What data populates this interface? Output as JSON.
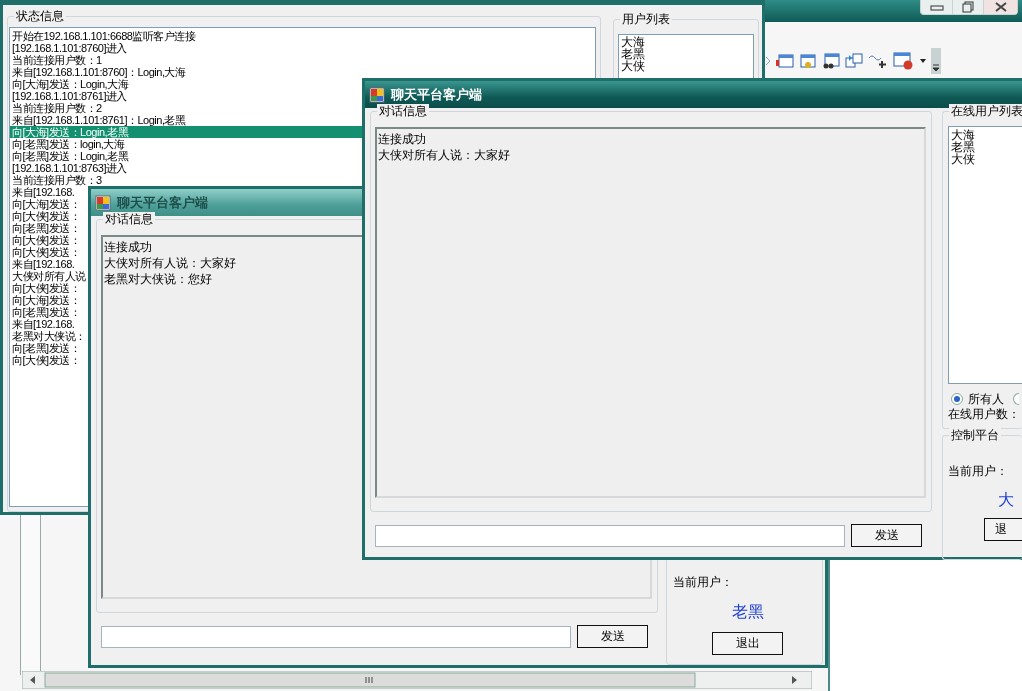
{
  "server_window": {
    "status_group": {
      "title": "状态信息",
      "lines": [
        {
          "text": "开始在192.168.1.101:6688监听客户连接",
          "selected": false
        },
        {
          "text": "[192.168.1.101:8760]进入",
          "selected": false
        },
        {
          "text": "当前连接用户数：1",
          "selected": false
        },
        {
          "text": "来自[192.168.1.101:8760]：Login,大海",
          "selected": false
        },
        {
          "text": "向[大海]发送：Login,大海",
          "selected": false
        },
        {
          "text": "[192.168.1.101:8761]进入",
          "selected": false
        },
        {
          "text": "当前连接用户数：2",
          "selected": false
        },
        {
          "text": "来自[192.168.1.101:8761]：Login,老黑",
          "selected": false
        },
        {
          "text": "向[大海]发送：Login,老黑",
          "selected": true
        },
        {
          "text": "向[老黑]发送：login,大海",
          "selected": false
        },
        {
          "text": "向[老黑]发送：Login,老黑",
          "selected": false
        },
        {
          "text": "[192.168.1.101:8763]进入",
          "selected": false
        },
        {
          "text": "当前连接用户数：3",
          "selected": false
        },
        {
          "text": "来自[192.168.",
          "selected": false
        },
        {
          "text": "向[大海]发送：",
          "selected": false
        },
        {
          "text": "向[大侠]发送：",
          "selected": false
        },
        {
          "text": "向[老黑]发送：",
          "selected": false
        },
        {
          "text": "向[大侠]发送：",
          "selected": false
        },
        {
          "text": "向[大侠]发送：",
          "selected": false
        },
        {
          "text": "来自[192.168.",
          "selected": false
        },
        {
          "text": "大侠对所有人说",
          "selected": false
        },
        {
          "text": "向[大侠]发送：",
          "selected": false
        },
        {
          "text": "向[大海]发送：",
          "selected": false
        },
        {
          "text": "向[老黑]发送：",
          "selected": false
        },
        {
          "text": "来自[192.168.",
          "selected": false
        },
        {
          "text": "老黑对大侠说：",
          "selected": false
        },
        {
          "text": "向[老黑]发送：",
          "selected": false
        },
        {
          "text": "向[大侠]发送：",
          "selected": false
        }
      ]
    },
    "users_group": {
      "title": "用户列表",
      "users": [
        "大海",
        "老黑",
        "大侠"
      ]
    }
  },
  "client_back": {
    "title": "聊天平台客户端",
    "active": false,
    "chat_group": {
      "title": "对话信息",
      "messages": [
        "连接成功",
        "大侠对所有人说：大家好",
        "老黑对大侠说：您好"
      ]
    },
    "send_button": "发送",
    "control_group": {
      "current_user_label": "当前用户：",
      "current_user": "老黑",
      "exit_button": "退出"
    }
  },
  "client_front": {
    "title": "聊天平台客户端",
    "active": true,
    "chat_group": {
      "title": "对话信息",
      "messages": [
        "连接成功",
        "大侠对所有人说：大家好"
      ]
    },
    "send_button": "发送",
    "online_group": {
      "title": "在线用户列表",
      "users": [
        "大海",
        "老黑",
        "大侠"
      ],
      "radios": [
        {
          "label": "所有人",
          "selected": true
        },
        {
          "selected": false
        }
      ],
      "online_count_label": "在线用户数："
    },
    "control_group": {
      "title": "控制平台",
      "current_user_label": "当前用户：",
      "current_user": "大",
      "exit_button": "退"
    }
  }
}
